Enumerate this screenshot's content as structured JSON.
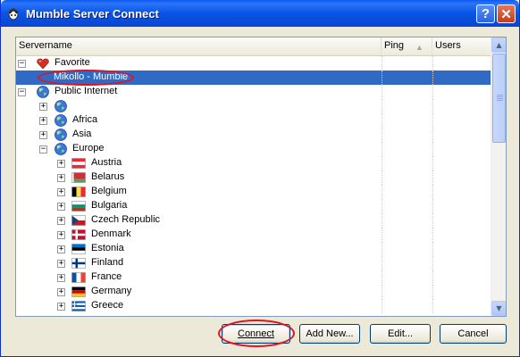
{
  "window": {
    "title": "Mumble Server Connect",
    "help_glyph": "?",
    "close_glyph": "✕"
  },
  "columns": {
    "name": "Servername",
    "ping": "Ping",
    "users": "Users"
  },
  "tree": [
    {
      "label": "Favorite",
      "icon": "heart-icon",
      "level": 0,
      "expander": "−"
    },
    {
      "label": "Mikollo - Mumble",
      "icon": "none",
      "level": 1,
      "expander": "",
      "selected": true
    },
    {
      "label": "Public Internet",
      "icon": "globe-icon",
      "level": 0,
      "expander": "−"
    },
    {
      "label": "",
      "icon": "globe-icon",
      "level": 1,
      "expander": "+"
    },
    {
      "label": "Africa",
      "icon": "globe-icon",
      "level": 1,
      "expander": "+"
    },
    {
      "label": "Asia",
      "icon": "globe-icon",
      "level": 1,
      "expander": "+"
    },
    {
      "label": "Europe",
      "icon": "globe-icon",
      "level": 1,
      "expander": "−"
    },
    {
      "label": "Austria",
      "icon": "flag-austria-icon",
      "level": 2,
      "expander": "+"
    },
    {
      "label": "Belarus",
      "icon": "flag-belarus-icon",
      "level": 2,
      "expander": "+"
    },
    {
      "label": "Belgium",
      "icon": "flag-belgium-icon",
      "level": 2,
      "expander": "+"
    },
    {
      "label": "Bulgaria",
      "icon": "flag-bulgaria-icon",
      "level": 2,
      "expander": "+"
    },
    {
      "label": "Czech Republic",
      "icon": "flag-czech-republic-icon",
      "level": 2,
      "expander": "+"
    },
    {
      "label": "Denmark",
      "icon": "flag-denmark-icon",
      "level": 2,
      "expander": "+"
    },
    {
      "label": "Estonia",
      "icon": "flag-estonia-icon",
      "level": 2,
      "expander": "+"
    },
    {
      "label": "Finland",
      "icon": "flag-finland-icon",
      "level": 2,
      "expander": "+"
    },
    {
      "label": "France",
      "icon": "flag-france-icon",
      "level": 2,
      "expander": "+"
    },
    {
      "label": "Germany",
      "icon": "flag-germany-icon",
      "level": 2,
      "expander": "+"
    },
    {
      "label": "Greece",
      "icon": "flag-greece-icon",
      "level": 2,
      "expander": "+"
    }
  ],
  "buttons": {
    "connect": "Connect",
    "add_new": "Add New...",
    "edit": "Edit...",
    "cancel": "Cancel"
  },
  "colors": {
    "selection": "#316ac5",
    "annotation": "#e0141e",
    "titlebar": "#0a54e6"
  }
}
